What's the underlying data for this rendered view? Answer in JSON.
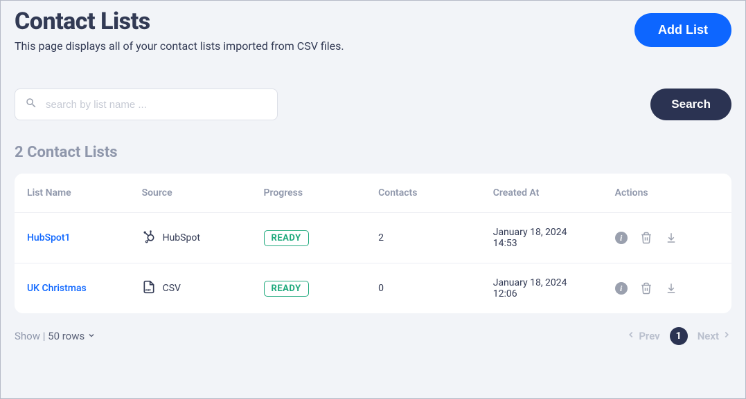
{
  "header": {
    "title": "Contact Lists",
    "subtitle": "This page displays all of your contact lists imported from CSV files.",
    "add_button": "Add List"
  },
  "search": {
    "placeholder": "search by list name ...",
    "button": "Search"
  },
  "summary": {
    "count_label": "2 Contact Lists"
  },
  "table": {
    "columns": {
      "list_name": "List Name",
      "source": "Source",
      "progress": "Progress",
      "contacts": "Contacts",
      "created_at": "Created At",
      "actions": "Actions"
    },
    "rows": [
      {
        "list_name": "HubSpot1",
        "source": "HubSpot",
        "source_icon": "hubspot-icon",
        "progress": "READY",
        "contacts": "2",
        "created_at": "January 18, 2024 14:53"
      },
      {
        "list_name": "UK Christmas",
        "source": "CSV",
        "source_icon": "csv-file-icon",
        "progress": "READY",
        "contacts": "0",
        "created_at": "January 18, 2024 12:06"
      }
    ]
  },
  "footer": {
    "show_label": "Show",
    "separator": "|",
    "rows_value": "50 rows",
    "prev": "Prev",
    "next": "Next",
    "current_page": "1"
  }
}
